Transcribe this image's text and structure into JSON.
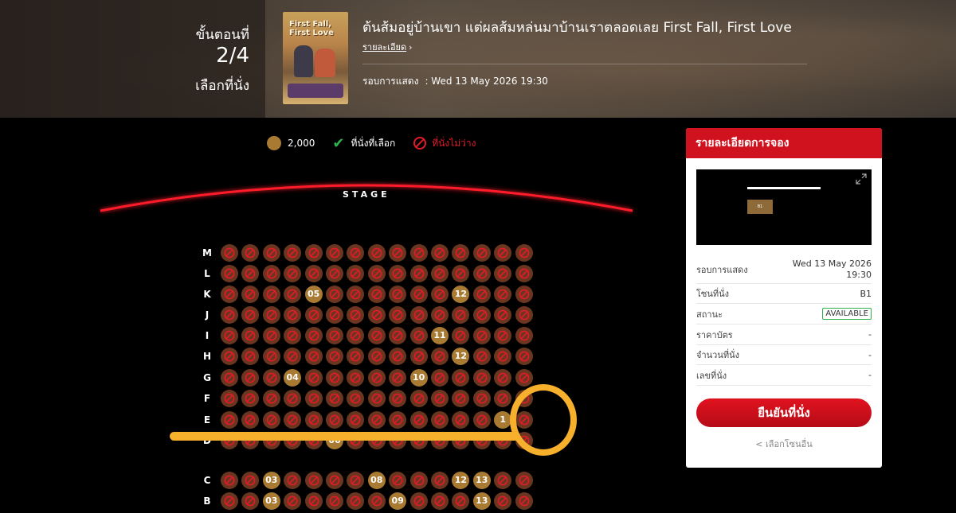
{
  "step": {
    "label": "ขั้นตอนที่",
    "number": "2/4",
    "name": "เลือกที่นั่ง"
  },
  "movie": {
    "title": "ต้นส้มอยู่บ้านเขา แต่ผลส้มหล่นมาบ้านเราตลอดเลย First Fall, First Love",
    "detail_link": "รายละเอียด",
    "showtime_label": "รอบการแสดง",
    "showtime_value": ": Wed 13 May 2026 19:30",
    "poster_text": "First Fall, First Love"
  },
  "legend": {
    "price": "2,000",
    "selected": "ที่นั่งที่เลือก",
    "unavailable": "ที่นั่งไม่ว่าง"
  },
  "stage": {
    "label": "STAGE"
  },
  "seatmap": {
    "colors": {
      "available": "#a87a32",
      "unavailable": "#6b3620",
      "mark": "#e21a2a"
    },
    "seats_per_row": 15,
    "rows": [
      {
        "label": "M",
        "available": []
      },
      {
        "label": "L",
        "available": []
      },
      {
        "label": "K",
        "available": [
          {
            "seat": 5,
            "text": "05"
          },
          {
            "seat": 12,
            "text": "12"
          }
        ]
      },
      {
        "label": "J",
        "available": []
      },
      {
        "label": "I",
        "available": [
          {
            "seat": 11,
            "text": "11"
          }
        ]
      },
      {
        "label": "H",
        "available": [
          {
            "seat": 12,
            "text": "12"
          }
        ]
      },
      {
        "label": "G",
        "available": [
          {
            "seat": 4,
            "text": "04"
          },
          {
            "seat": 10,
            "text": "10"
          }
        ]
      },
      {
        "label": "F",
        "available": []
      },
      {
        "label": "E",
        "available": [
          {
            "seat": 14,
            "text": "1"
          }
        ]
      },
      {
        "label": "D",
        "available": [
          {
            "seat": 6,
            "text": "06"
          }
        ]
      },
      {
        "label": "C",
        "available": [
          {
            "seat": 3,
            "text": "03"
          },
          {
            "seat": 8,
            "text": "08"
          },
          {
            "seat": 12,
            "text": "12"
          },
          {
            "seat": 13,
            "text": "13"
          }
        ]
      },
      {
        "label": "B",
        "available": [
          {
            "seat": 3,
            "text": "03"
          },
          {
            "seat": 9,
            "text": "09"
          },
          {
            "seat": 13,
            "text": "13"
          }
        ]
      }
    ]
  },
  "panel": {
    "title": "รายละเอียดการจอง",
    "minimap_seat": "B1",
    "details": [
      {
        "key": "รอบการแสดง",
        "value": "Wed 13 May 2026 19:30",
        "badge": false
      },
      {
        "key": "โซนที่นั่ง",
        "value": "B1",
        "badge": false
      },
      {
        "key": "สถานะ",
        "value": "AVAILABLE",
        "badge": true
      },
      {
        "key": "ราคาบัตร",
        "value": "-",
        "badge": false
      },
      {
        "key": "จำนวนที่นั่ง",
        "value": "-",
        "badge": false
      },
      {
        "key": "เลขที่นั่ง",
        "value": "-",
        "badge": false
      }
    ],
    "confirm": "ยืนยันที่นั่ง",
    "other_zone": "< เลือกโซนอื่น"
  },
  "annotation": {
    "color": "#f7b02c"
  }
}
